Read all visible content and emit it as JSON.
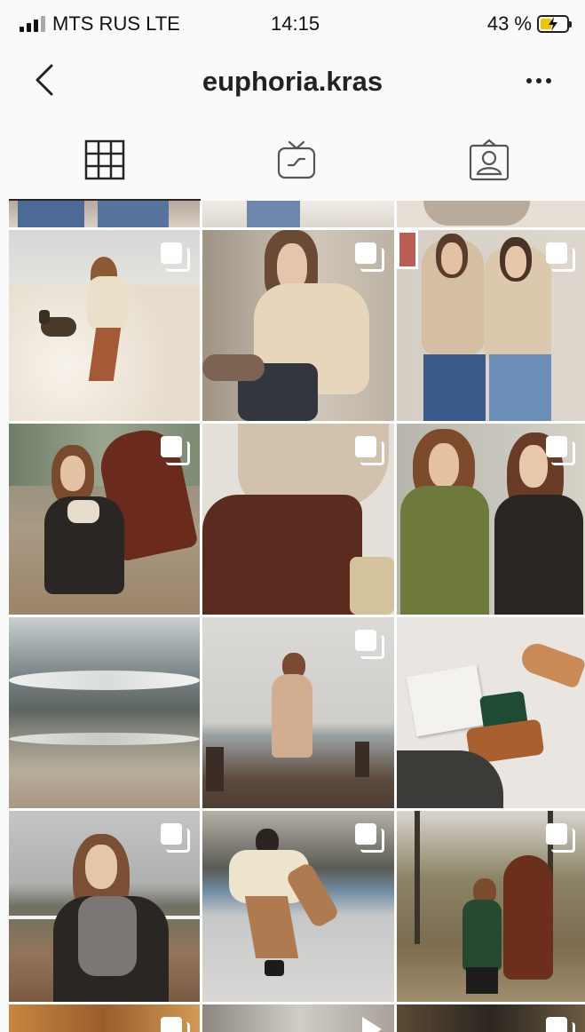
{
  "status_bar": {
    "carrier": "MTS RUS LTE",
    "time": "14:15",
    "battery_percent": "43 %",
    "battery_level": 0.43,
    "battery_color": "#f4c300"
  },
  "nav": {
    "back_icon": "chevron-left-icon",
    "username": "euphoria.kras",
    "more_icon": "more-horizontal-icon"
  },
  "tabs": [
    {
      "icon": "grid-icon",
      "active": true
    },
    {
      "icon": "igtv-icon",
      "active": false
    },
    {
      "icon": "tagged-person-icon",
      "active": false
    }
  ],
  "grid": {
    "posts": [
      {
        "subject": "jeans-partial",
        "multi": false
      },
      {
        "subject": "snow-partial",
        "multi": false
      },
      {
        "subject": "chair-partial",
        "multi": false
      },
      {
        "subject": "woman-dog-snow",
        "multi": true
      },
      {
        "subject": "beige-sweater-knees",
        "multi": true
      },
      {
        "subject": "two-women-hoodies",
        "multi": true
      },
      {
        "subject": "woman-horse-jacket",
        "multi": true
      },
      {
        "subject": "sweater-brown-pants",
        "multi": true
      },
      {
        "subject": "two-women-jackets",
        "multi": true
      },
      {
        "subject": "sea-waves",
        "multi": false
      },
      {
        "subject": "woman-coat-pier",
        "multi": true
      },
      {
        "subject": "shoes-book-flatlay",
        "multi": false
      },
      {
        "subject": "woman-gray-sweater",
        "multi": true
      },
      {
        "subject": "woman-dancing-puffer",
        "multi": true
      },
      {
        "subject": "woman-horse-forest",
        "multi": true
      },
      {
        "subject": "bottom-partial-1",
        "multi": true
      },
      {
        "subject": "bottom-partial-2",
        "multi": false,
        "video": true
      },
      {
        "subject": "bottom-partial-3",
        "multi": true
      }
    ]
  }
}
